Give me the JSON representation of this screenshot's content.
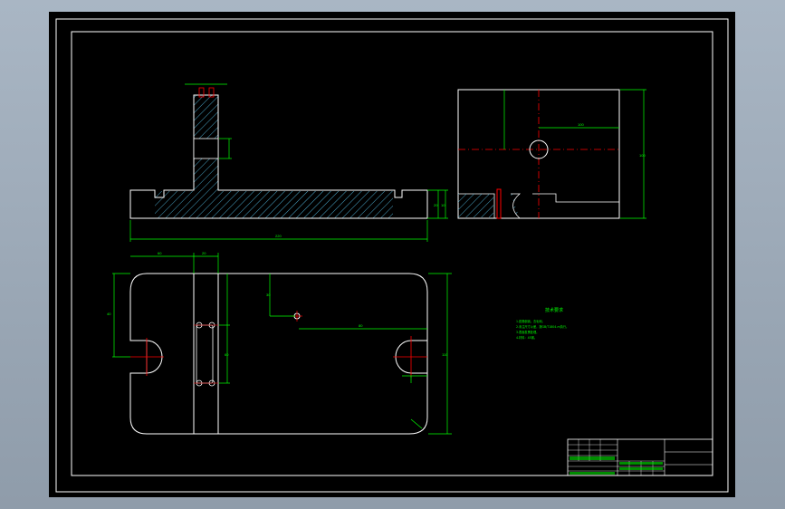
{
  "drawing": {
    "colors": {
      "outline": "#ffffff",
      "dimension": "#00ff00",
      "centerline": "#ff0000",
      "hatch": "#4aa6c8",
      "background": "#000000"
    },
    "tech_notes": {
      "title": "技术要求",
      "lines": [
        "1.锐角倒钝，去毛刺。",
        "2.未注尺寸公差，按GB/T1804-m执行。",
        "3.表面发黑处理。",
        "4.材料：45钢。"
      ]
    },
    "dimensions": {
      "front_width": "220",
      "front_height_a": "20",
      "front_height_b": "10",
      "side_height": "100",
      "side_width": "100",
      "plan_width": "220",
      "plan_depth": "110",
      "plan_hole_x": "80",
      "plan_hole_y": "30",
      "plan_left_a": "60",
      "plan_left_b": "20",
      "plan_slot_y": "40",
      "plan_slot_len": "60"
    },
    "title_block": {
      "cells": [
        "",
        "",
        "",
        "",
        "",
        ""
      ]
    }
  }
}
